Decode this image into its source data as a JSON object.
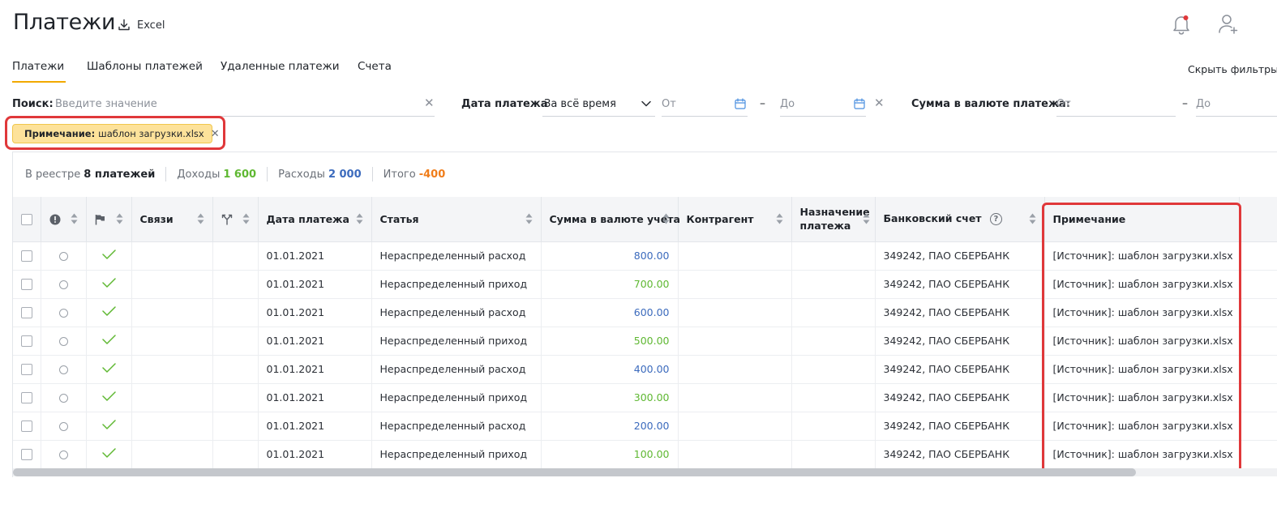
{
  "header": {
    "title": "Платежи",
    "excel_label": "Excel"
  },
  "tabs": [
    {
      "label": "Платежи",
      "active": true
    },
    {
      "label": "Шаблоны платежей",
      "active": false
    },
    {
      "label": "Удаленные платежи",
      "active": false
    },
    {
      "label": "Счета",
      "active": false
    }
  ],
  "hide_filters_label": "Скрыть фильтры",
  "filters": {
    "search_label": "Поиск:",
    "search_placeholder": "Введите значение",
    "date_label": "Дата платежа",
    "date_period": "За всё время",
    "date_from_placeholder": "От",
    "date_to_placeholder": "До",
    "range_dash": "–",
    "sum_label": "Сумма в валюте платежа:",
    "sum_from_placeholder": "От",
    "sum_to_placeholder": "До"
  },
  "chip": {
    "label": "Примечание:",
    "value": "шаблон загрузки.xlsx"
  },
  "summary": {
    "registry_label": "В реестре",
    "registry_value": "8 платежей",
    "income_label": "Доходы",
    "income_value": "1 600",
    "expense_label": "Расходы",
    "expense_value": "2 000",
    "total_label": "Итого",
    "total_value": "-400"
  },
  "columns": {
    "links": "Связи",
    "date": "Дата платежа",
    "article": "Статья",
    "amount": "Сумма в валюте учета",
    "counterparty": "Контрагент",
    "purpose": "Назначение платежа",
    "bank_account": "Банковский счет",
    "notes": "Примечание"
  },
  "rows": [
    {
      "date": "01.01.2021",
      "article": "Нераспределенный расход",
      "amount": "800.00",
      "kind": "expense",
      "bank_account": "349242, ПАО СБЕРБАНК",
      "notes": "[Источник]: шаблон загрузки.xlsx"
    },
    {
      "date": "01.01.2021",
      "article": "Нераспределенный приход",
      "amount": "700.00",
      "kind": "income",
      "bank_account": "349242, ПАО СБЕРБАНК",
      "notes": "[Источник]: шаблон загрузки.xlsx"
    },
    {
      "date": "01.01.2021",
      "article": "Нераспределенный расход",
      "amount": "600.00",
      "kind": "expense",
      "bank_account": "349242, ПАО СБЕРБАНК",
      "notes": "[Источник]: шаблон загрузки.xlsx"
    },
    {
      "date": "01.01.2021",
      "article": "Нераспределенный приход",
      "amount": "500.00",
      "kind": "income",
      "bank_account": "349242, ПАО СБЕРБАНК",
      "notes": "[Источник]: шаблон загрузки.xlsx"
    },
    {
      "date": "01.01.2021",
      "article": "Нераспределенный расход",
      "amount": "400.00",
      "kind": "expense",
      "bank_account": "349242, ПАО СБЕРБАНК",
      "notes": "[Источник]: шаблон загрузки.xlsx"
    },
    {
      "date": "01.01.2021",
      "article": "Нераспределенный приход",
      "amount": "300.00",
      "kind": "income",
      "bank_account": "349242, ПАО СБЕРБАНК",
      "notes": "[Источник]: шаблон загрузки.xlsx"
    },
    {
      "date": "01.01.2021",
      "article": "Нераспределенный расход",
      "amount": "200.00",
      "kind": "expense",
      "bank_account": "349242, ПАО СБЕРБАНК",
      "notes": "[Источник]: шаблон загрузки.xlsx"
    },
    {
      "date": "01.01.2021",
      "article": "Нераспределенный приход",
      "amount": "100.00",
      "kind": "income",
      "bank_account": "349242, ПАО СБЕРБАНК",
      "notes": "[Источник]: шаблон загрузки.xlsx"
    }
  ],
  "colors": {
    "accent": "#f2a900",
    "highlight": "#e0383a",
    "income": "#5fb832",
    "expense": "#3c6bbd",
    "total": "#f07d1a"
  }
}
